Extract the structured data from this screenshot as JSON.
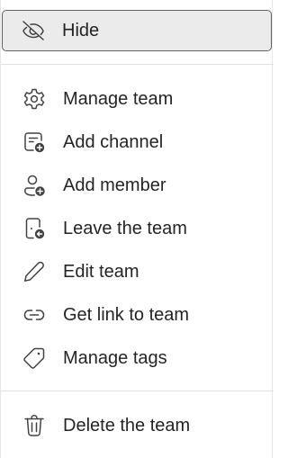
{
  "menu": {
    "items": [
      {
        "label": "Hide",
        "icon": "eye-off-icon"
      },
      {
        "label": "Manage team",
        "icon": "gear-icon"
      },
      {
        "label": "Add channel",
        "icon": "add-channel-icon"
      },
      {
        "label": "Add member",
        "icon": "add-person-icon"
      },
      {
        "label": "Leave the team",
        "icon": "leave-door-icon"
      },
      {
        "label": "Edit team",
        "icon": "pencil-icon"
      },
      {
        "label": "Get link to team",
        "icon": "link-icon"
      },
      {
        "label": "Manage tags",
        "icon": "tag-icon"
      },
      {
        "label": "Delete the team",
        "icon": "trash-icon"
      }
    ]
  }
}
